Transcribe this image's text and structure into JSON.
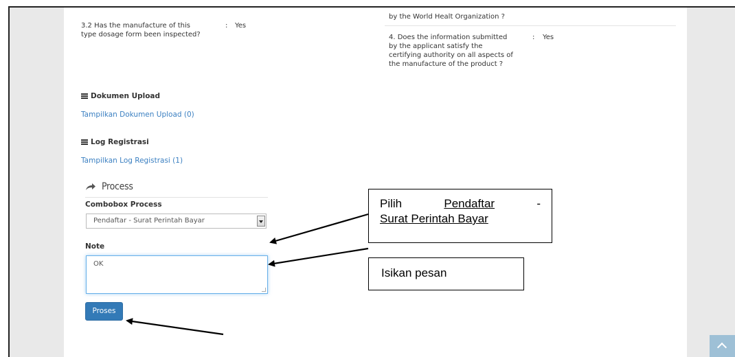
{
  "qa": {
    "q32_label": "3.2 Has the manufacture of this",
    "q32_label2": "type dosage form been inspected?",
    "q32_sep": ":",
    "q32_value": "Yes",
    "q_top_right": "by the World Healt Organization ?",
    "q4_line1": "4. Does the information submitted",
    "q4_line2": "by the applicant satisfy the",
    "q4_line3": "certifying authority on all aspects of",
    "q4_line4": "the manufacture of the product ?",
    "q4_sep": ":",
    "q4_value": "Yes"
  },
  "dokumen": {
    "title": "Dokumen Upload",
    "link": "Tampilkan Dokumen Upload (0)"
  },
  "log": {
    "title": "Log Registrasi",
    "link": "Tampilkan Log Registrasi (1)"
  },
  "process": {
    "heading": "Process",
    "combobox_label": "Combobox Process",
    "combobox_value": "Pendaftar - Surat Perintah Bayar",
    "note_label": "Note",
    "note_value": "OK",
    "submit_label": "Proses"
  },
  "callouts": {
    "pilih_prefix": "Pilih",
    "pilih_target_1": "Pendaftar",
    "pilih_dash": "-",
    "pilih_target_2": "Surat Perintah Bayar",
    "isikan": "Isikan pesan"
  },
  "icons": [
    "list-icon",
    "share-arrow-icon",
    "chevron-down-icon",
    "chevron-up-icon"
  ]
}
